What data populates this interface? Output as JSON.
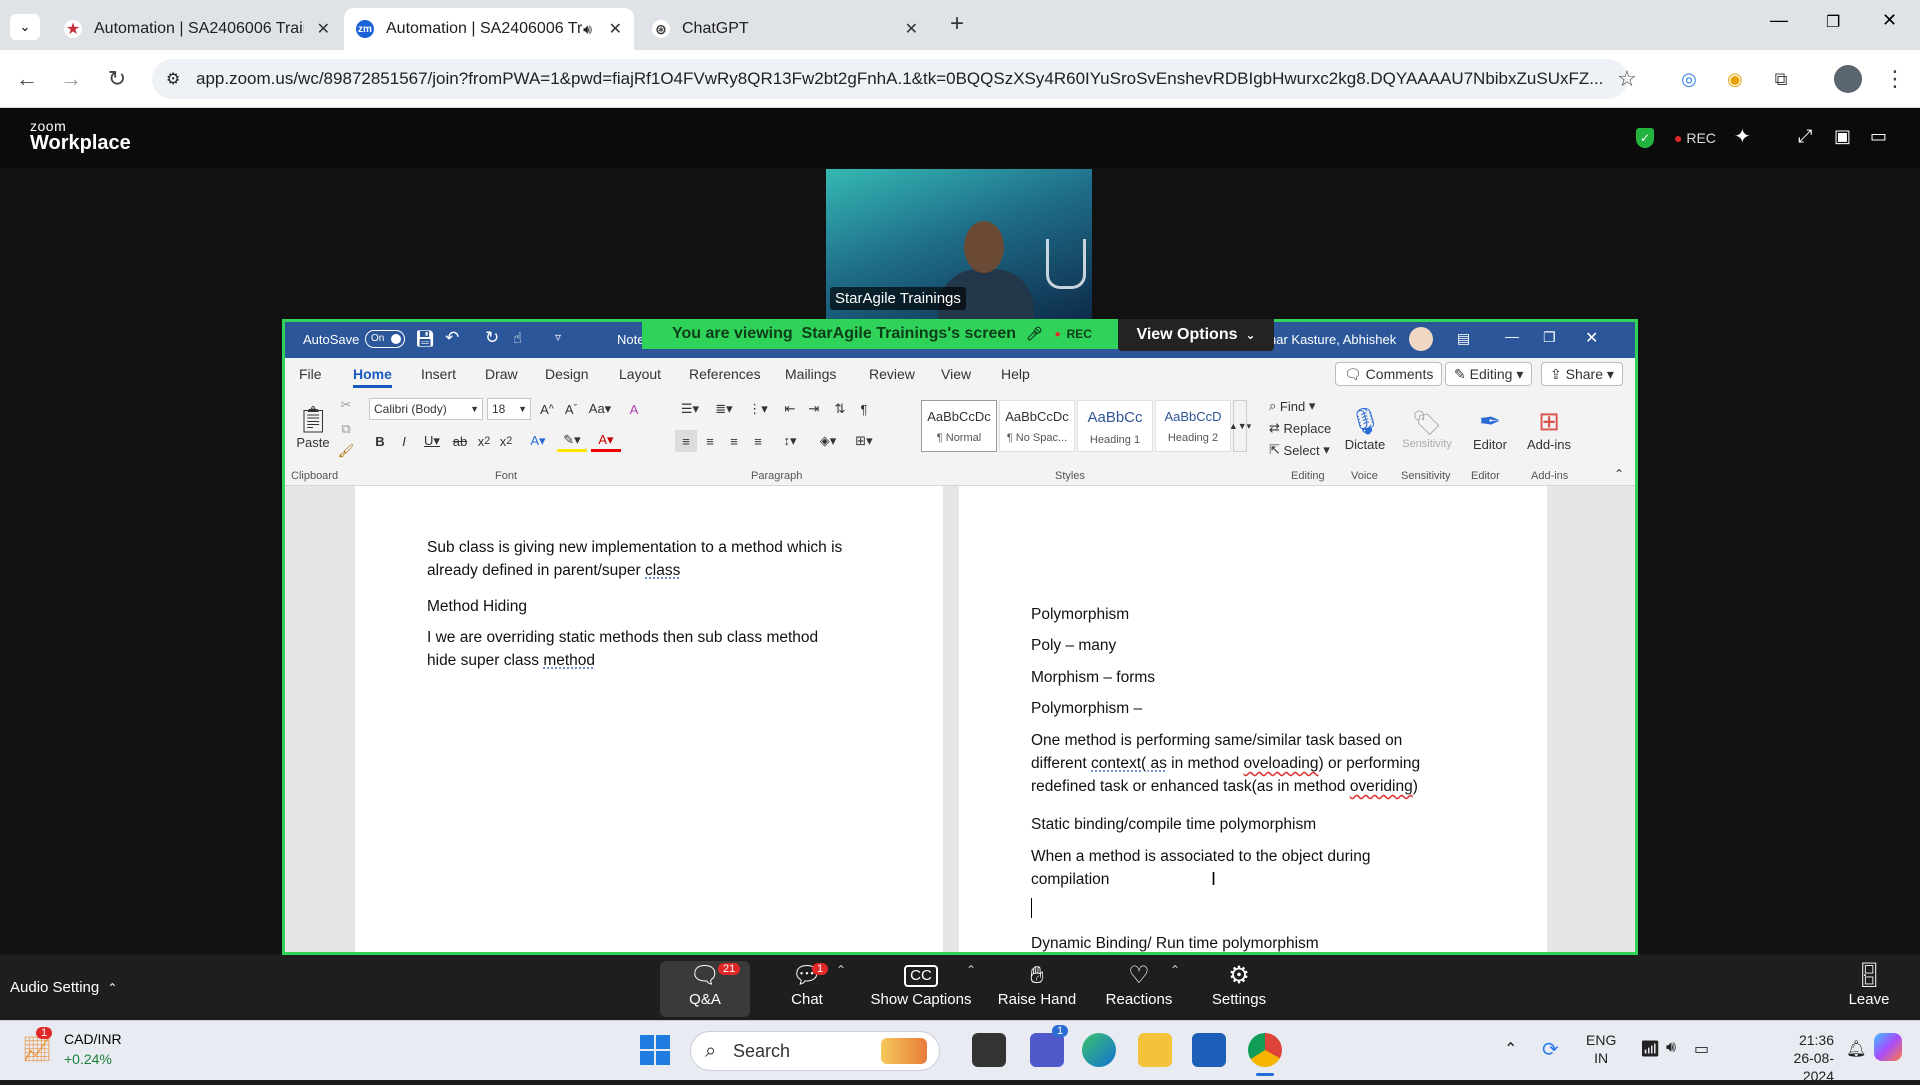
{
  "browser": {
    "tabs": [
      {
        "label": "Automation | SA2406006 Traini",
        "active": false
      },
      {
        "label": "Automation | SA2406006 Tr",
        "active": true
      },
      {
        "label": "ChatGPT",
        "active": false
      }
    ],
    "url": "app.zoom.us/wc/89872851567/join?fromPWA=1&pwd=fiajRf1O4FVwRy8QR13Fw2bt2gFnhA.1&tk=0BQQSzXSy4R60IYuSroSvEnshevRDBIgbHwurxc2kg8.DQYAAAAU7NbibxZuSUxFZ..."
  },
  "zoom": {
    "logo_small": "zoom",
    "logo_big": "Workplace",
    "rec": "REC",
    "speaker_name": "StarAgile Trainings",
    "viewing_prefix": "You are viewing",
    "viewing_name": "StarAgile Trainings's screen",
    "banner_rec": "REC",
    "view_options": "View Options",
    "audio_setting": "Audio Setting",
    "toolbar": {
      "qa": "Q&A",
      "qa_badge": "21",
      "chat": "Chat",
      "chat_badge": "1",
      "captions": "Show Captions",
      "raise": "Raise Hand",
      "reactions": "Reactions",
      "settings": "Settings",
      "leave": "Leave"
    }
  },
  "word": {
    "autosave": "AutoSave",
    "autosave_state": "On",
    "doc_title": "Note",
    "user": "nar Kasture, Abhishek",
    "menu": [
      "File",
      "Home",
      "Insert",
      "Draw",
      "Design",
      "Layout",
      "References",
      "Mailings",
      "Review",
      "View",
      "Help"
    ],
    "comments": "Comments",
    "editing": "Editing",
    "share": "Share",
    "font_name": "Calibri (Body)",
    "font_size": "18",
    "paste": "Paste",
    "styles": [
      {
        "preview": "AaBbCcDc",
        "name": "¶ Normal"
      },
      {
        "preview": "AaBbCcDc",
        "name": "¶ No Spac..."
      },
      {
        "preview": "AaBbCc",
        "name": "Heading 1"
      },
      {
        "preview": "AaBbCcD",
        "name": "Heading 2"
      }
    ],
    "find": "Find",
    "replace": "Replace",
    "select": "Select",
    "dictate": "Dictate",
    "sensitivity": "Sensitivity",
    "editor": "Editor",
    "addins": "Add-ins",
    "groups": {
      "clipboard": "Clipboard",
      "font": "Font",
      "paragraph": "Paragraph",
      "styles": "Styles",
      "editing": "Editing",
      "voice": "Voice",
      "sensitivity": "Sensitivity",
      "editor": "Editor",
      "addins": "Add-ins"
    },
    "left_page": {
      "p1a": "Sub class is giving new implementation to a method which is",
      "p1b": "already defined in parent/super ",
      "p1c": "class",
      "p2": "Method Hiding",
      "p3a": "I we are overriding static methods then sub class method",
      "p3b": "hide super class ",
      "p3c": "method"
    },
    "right_page": {
      "l1": "Polymorphism",
      "l2": "Poly – many",
      "l3": "Morphism – forms",
      "l4": "Polymorphism –",
      "l5a": "One method is performing same/similar task based on",
      "l5b1": "different ",
      "l5b2": "context( as",
      "l5b3": " in method ",
      "l5b4": "oveloading",
      "l5b5": ") or performing",
      "l5c1": "redefined task or enhanced task(as in method ",
      "l5c2": "overiding",
      "l5c3": ")",
      "l6": "Static binding/compile time polymorphism",
      "l7a": "When a method is associated to the object during",
      "l7b": "compilation",
      "l8": "Dynamic Binding/ Run time polymorphism"
    }
  },
  "taskbar": {
    "stock_name": "CAD/INR",
    "stock_change": "+0.24%",
    "stock_badge": "1",
    "search": "Search",
    "lang1": "ENG",
    "lang2": "IN",
    "time": "21:36",
    "date": "26-08-2024",
    "teams_badge": "1"
  }
}
